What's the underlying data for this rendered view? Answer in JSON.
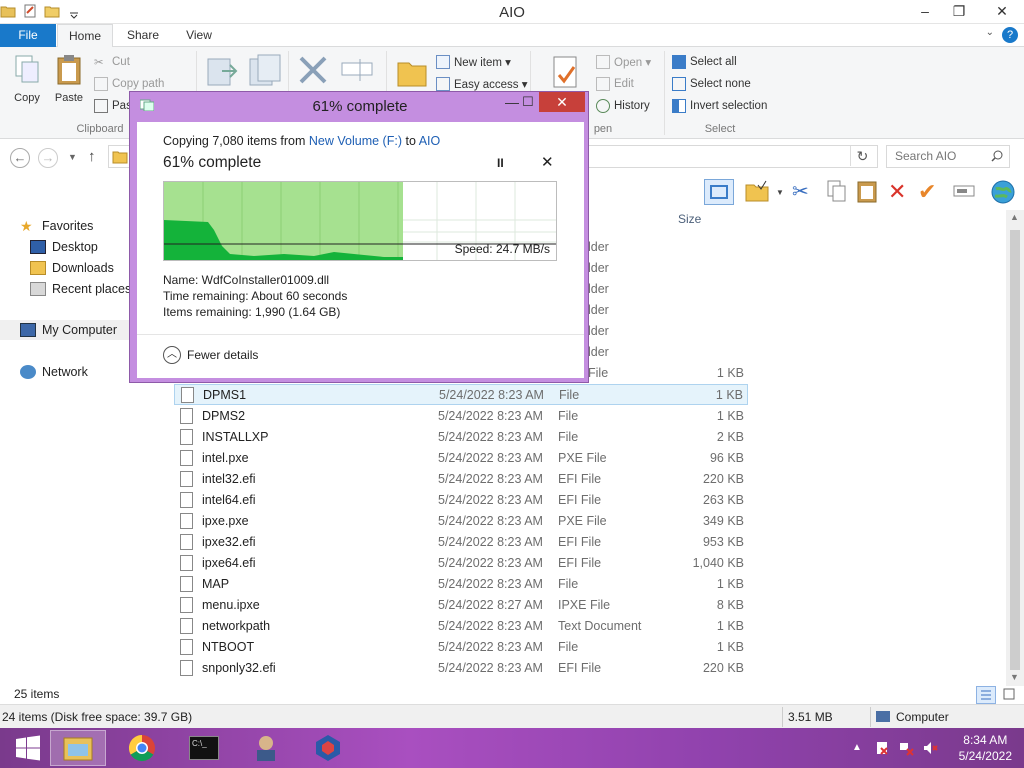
{
  "window": {
    "title": "AIO",
    "minimize": "–",
    "maximize": "❐",
    "close": "✕"
  },
  "ribbon": {
    "tabs": {
      "file": "File",
      "home": "Home",
      "share": "Share",
      "view": "View"
    },
    "help": "?",
    "clipboard": {
      "copy": "Copy",
      "paste": "Paste",
      "cut": "Cut",
      "copy_path": "Copy path",
      "paste_shortcut": "Pas",
      "group_label": "Clipboard"
    },
    "new": {
      "new_item": "New item ▾",
      "easy_access": "Easy access ▾"
    },
    "open": {
      "open": "Open ▾",
      "edit": "Edit",
      "history": "History",
      "group_label": "pen"
    },
    "select": {
      "select_all": "Select all",
      "select_none": "Select none",
      "invert_selection": "Invert selection",
      "group_label": "Select"
    }
  },
  "addressbar": {
    "search_placeholder": "Search AIO"
  },
  "navpane": {
    "favorites": "Favorites",
    "desktop": "Desktop",
    "downloads": "Downloads",
    "recent_places": "Recent places",
    "my_computer": "My Computer",
    "network": "Network"
  },
  "filelist": {
    "size_header": "Size",
    "partial_rows": [
      {
        "type": "lder",
        "size": ""
      },
      {
        "type": "lder",
        "size": ""
      },
      {
        "type": "lder",
        "size": ""
      },
      {
        "type": "lder",
        "size": ""
      },
      {
        "type": "lder",
        "size": ""
      },
      {
        "type": "lder",
        "size": ""
      },
      {
        "type": "File",
        "size": "1 KB"
      }
    ],
    "rows": [
      {
        "name": "DPMS1",
        "date": "5/24/2022 8:23 AM",
        "type": "File",
        "size": "1 KB"
      },
      {
        "name": "DPMS2",
        "date": "5/24/2022 8:23 AM",
        "type": "File",
        "size": "1 KB"
      },
      {
        "name": "INSTALLXP",
        "date": "5/24/2022 8:23 AM",
        "type": "File",
        "size": "2 KB"
      },
      {
        "name": "intel.pxe",
        "date": "5/24/2022 8:23 AM",
        "type": "PXE File",
        "size": "96 KB"
      },
      {
        "name": "intel32.efi",
        "date": "5/24/2022 8:23 AM",
        "type": "EFI File",
        "size": "220 KB"
      },
      {
        "name": "intel64.efi",
        "date": "5/24/2022 8:23 AM",
        "type": "EFI File",
        "size": "263 KB"
      },
      {
        "name": "ipxe.pxe",
        "date": "5/24/2022 8:23 AM",
        "type": "PXE File",
        "size": "349 KB"
      },
      {
        "name": "ipxe32.efi",
        "date": "5/24/2022 8:23 AM",
        "type": "EFI File",
        "size": "953 KB"
      },
      {
        "name": "ipxe64.efi",
        "date": "5/24/2022 8:23 AM",
        "type": "EFI File",
        "size": "1,040 KB"
      },
      {
        "name": "MAP",
        "date": "5/24/2022 8:23 AM",
        "type": "File",
        "size": "1 KB"
      },
      {
        "name": "menu.ipxe",
        "date": "5/24/2022 8:27 AM",
        "type": "IPXE File",
        "size": "8 KB"
      },
      {
        "name": "networkpath",
        "date": "5/24/2022 8:23 AM",
        "type": "Text Document",
        "size": "1 KB"
      },
      {
        "name": "NTBOOT",
        "date": "5/24/2022 8:23 AM",
        "type": "File",
        "size": "1 KB"
      },
      {
        "name": "snponly32.efi",
        "date": "5/24/2022 8:23 AM",
        "type": "EFI File",
        "size": "220 KB"
      }
    ]
  },
  "status": {
    "items_count": "25 items",
    "disk_info": "24 items (Disk free space: 39.7 GB)",
    "size_total": "3.51 MB",
    "computer": "Computer"
  },
  "dialog": {
    "title": "61% complete",
    "copying_prefix": "Copying 7,080 items from ",
    "source": "New Volume (F:)",
    "to_word": " to ",
    "destination": "AIO",
    "percent_text": "61% complete",
    "progress_fraction": 0.61,
    "speed": "Speed: 24.7 MB/s",
    "name_line": "Name:  WdfCoInstaller01009.dll",
    "time_line": "Time remaining:  About 60 seconds",
    "items_line": "Items remaining:  1,990 (1.64 GB)",
    "fewer_details": "Fewer details",
    "pause_symbol": "II",
    "cancel_symbol": "✕",
    "close_symbol": "✕",
    "minimize_symbol": "—",
    "maximize_symbol": "☐"
  },
  "taskbar": {
    "time": "8:34 AM",
    "date": "5/24/2022"
  },
  "colors": {
    "accent": "#1979ca",
    "progress_fill": "#a6e190",
    "progress_speed": "#14b33a",
    "dialog_frame": "#c48ee0",
    "close_red": "#c7403a"
  }
}
